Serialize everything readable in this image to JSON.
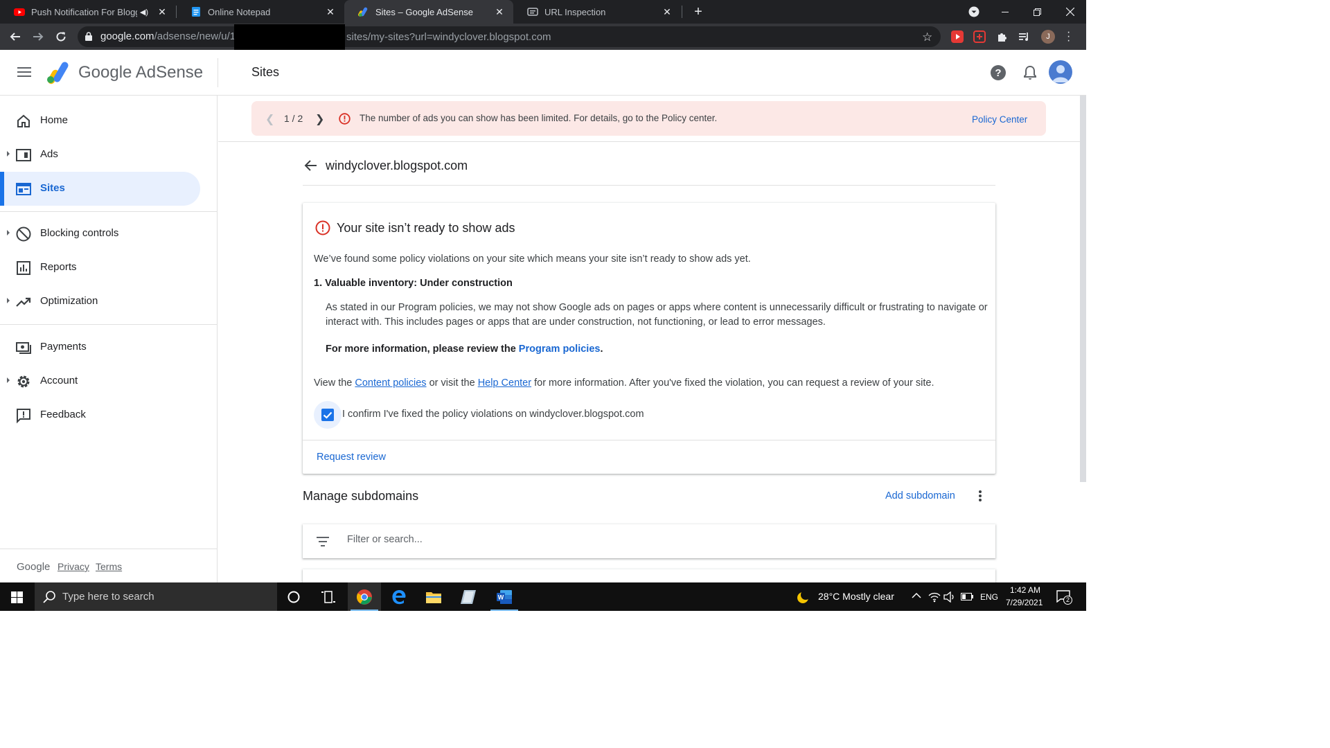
{
  "browser": {
    "tabs": [
      {
        "title": "Push Notification For Blogge",
        "audible": true,
        "active": false
      },
      {
        "title": "Online Notepad",
        "active": false
      },
      {
        "title": "Sites – Google AdSense",
        "active": true
      },
      {
        "title": "URL Inspection",
        "active": false
      }
    ],
    "url": {
      "host": "google.com",
      "path_visible": "/adsense/new/u/1,",
      "path_tail": "sites/my-sites?url=windyclover.blogspot.com"
    },
    "profile_initial": "J"
  },
  "header": {
    "brand": "Google AdSense",
    "page_title": "Sites"
  },
  "sidebar": {
    "items": [
      {
        "label": "Home",
        "icon": "home-icon",
        "expandable": false,
        "active": false
      },
      {
        "label": "Ads",
        "icon": "ads-icon",
        "expandable": true,
        "active": false
      },
      {
        "label": "Sites",
        "icon": "sites-icon",
        "expandable": false,
        "active": true
      },
      {
        "label": "Blocking controls",
        "icon": "block-icon",
        "expandable": true,
        "active": false
      },
      {
        "label": "Reports",
        "icon": "reports-icon",
        "expandable": false,
        "active": false
      },
      {
        "label": "Optimization",
        "icon": "trending-icon",
        "expandable": true,
        "active": false
      },
      {
        "label": "Payments",
        "icon": "payments-icon",
        "expandable": false,
        "active": false
      },
      {
        "label": "Account",
        "icon": "gear-icon",
        "expandable": true,
        "active": false
      },
      {
        "label": "Feedback",
        "icon": "feedback-icon",
        "expandable": false,
        "active": false
      }
    ],
    "footer": {
      "brand": "Google",
      "privacy": "Privacy",
      "terms": "Terms"
    }
  },
  "banner": {
    "page": "1 / 2",
    "message": "The number of ads you can show has been limited. For details, go to the Policy center.",
    "action": "Policy Center"
  },
  "site": {
    "name": "windyclover.blogspot.com"
  },
  "policy_card": {
    "title": "Your site isn’t ready to show ads",
    "intro": "We’ve found some policy violations on your site which means your site isn’t ready to show ads yet.",
    "item_title": "1. Valuable inventory: Under construction",
    "item_body": "As stated in our Program policies, we may not show Google ads on pages or apps where content is unnecessarily difficult or frustrating to navigate or interact with. This includes pages or apps that are under construction, not functioning, or lead to error messages.",
    "more_prefix": "For more information, please review the ",
    "more_link": "Program policies",
    "more_suffix": ".",
    "view_prefix": "View the ",
    "content_policies": "Content policies",
    "view_mid": " or visit the ",
    "help_center": "Help Center",
    "view_suffix": " for more information. After you've fixed the violation, you can request a review of your site.",
    "confirm_label": "I confirm I've fixed the policy violations on windyclover.blogspot.com",
    "confirm_checked": true,
    "request_review": "Request review"
  },
  "subdomains": {
    "title": "Manage subdomains",
    "add_label": "Add subdomain",
    "filter_placeholder": "Filter or search..."
  },
  "taskbar": {
    "search_placeholder": "Type here to search",
    "weather": "28°C  Mostly clear",
    "language": "ENG",
    "time": "1:42 AM",
    "date": "7/29/2021",
    "notifications": "2"
  },
  "colors": {
    "accent": "#1a73e8",
    "link": "#1967d2",
    "error": "#d93025",
    "banner_bg": "#fce8e6",
    "active_nav_bg": "#e8f0fe"
  }
}
